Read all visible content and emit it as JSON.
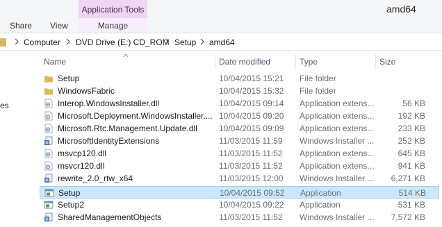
{
  "window": {
    "title": "amd64"
  },
  "ribbon": {
    "context_group": "Application Tools",
    "tabs": [
      "Share",
      "View",
      "Manage"
    ]
  },
  "address": {
    "crumbs": [
      "Computer",
      "DVD Drive (E:) CD_ROM",
      "Setup",
      "amd64"
    ]
  },
  "nav": {
    "partial_label": "es"
  },
  "columns": {
    "name": "Name",
    "date": "Date modified",
    "type": "Type",
    "size": "Size"
  },
  "files": [
    {
      "name": "Setup",
      "date": "10/04/2015 15:21",
      "type": "File folder",
      "size": "",
      "icon": "folder-icon"
    },
    {
      "name": "WindowsFabric",
      "date": "10/04/2015 15:32",
      "type": "File folder",
      "size": "",
      "icon": "folder-icon"
    },
    {
      "name": "Interop.WindowsInstaller.dll",
      "date": "10/04/2015 09:14",
      "type": "Application extens...",
      "size": "56 KB",
      "icon": "dll-icon"
    },
    {
      "name": "Microsoft.Deployment.WindowsInstaller....",
      "date": "10/04/2015 09:20",
      "type": "Application extens...",
      "size": "192 KB",
      "icon": "dll-icon"
    },
    {
      "name": "Microsoft.Rtc.Management.Update.dll",
      "date": "10/04/2015 09:09",
      "type": "Application extens...",
      "size": "233 KB",
      "icon": "dll-icon"
    },
    {
      "name": "MicrosoftIdentityExtensions",
      "date": "11/03/2015 11:59",
      "type": "Windows Installer ...",
      "size": "252 KB",
      "icon": "msi-icon"
    },
    {
      "name": "msvcp120.dll",
      "date": "11/03/2015 11:52",
      "type": "Application extens...",
      "size": "645 KB",
      "icon": "dll-icon"
    },
    {
      "name": "msvcr120.dll",
      "date": "11/03/2015 11:52",
      "type": "Application extens...",
      "size": "941 KB",
      "icon": "dll-icon"
    },
    {
      "name": "rewrite_2.0_rtw_x64",
      "date": "11/03/2015 12:00",
      "type": "Windows Installer ...",
      "size": "6,271 KB",
      "icon": "msi-icon"
    },
    {
      "name": "Setup",
      "date": "10/04/2015 09:52",
      "type": "Application",
      "size": "514 KB",
      "icon": "exe-icon",
      "selected": true
    },
    {
      "name": "Setup2",
      "date": "10/04/2015 09:22",
      "type": "Application",
      "size": "531 KB",
      "icon": "exe-icon"
    },
    {
      "name": "SharedManagementObjects",
      "date": "11/03/2015 11:52",
      "type": "Windows Installer ...",
      "size": "7,572 KB",
      "icon": "msi-icon"
    }
  ],
  "colors": {
    "selection": "#cce8ff",
    "selection_border": "#99d1ff",
    "context_tab": "#efd6f3",
    "folder": "#dcb85c"
  }
}
